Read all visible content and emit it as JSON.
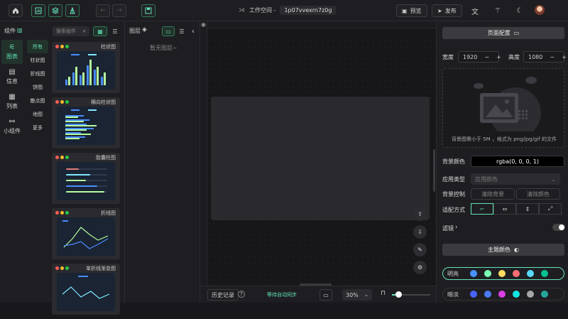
{
  "topbar": {
    "workspace_label": "工作空间 -",
    "workspace_name": "1p07vvexrn7z0g",
    "preview_label": "预览",
    "publish_label": "发布"
  },
  "components_panel": {
    "title": "组件",
    "search_placeholder": "搜索组件",
    "categories": [
      {
        "label": "图表",
        "icon": "chart-icon",
        "active": true
      },
      {
        "label": "信息",
        "icon": "info-icon",
        "active": false
      },
      {
        "label": "列表",
        "icon": "table-icon",
        "active": false
      },
      {
        "label": "小组件",
        "icon": "widget-icon",
        "active": false
      }
    ],
    "subcategories": [
      "所有",
      "柱状图",
      "折线图",
      "饼图",
      "散点图",
      "地图",
      "更多"
    ],
    "thumbnails": [
      {
        "title": "柱状图",
        "kind": "bar"
      },
      {
        "title": "横向柱状图",
        "kind": "hbar"
      },
      {
        "title": "胶囊柱图",
        "kind": "capsule"
      },
      {
        "title": "折线图",
        "kind": "line"
      },
      {
        "title": "单折线渐变图",
        "kind": "gradient-line"
      }
    ]
  },
  "layers_panel": {
    "title": "图层",
    "empty_text": "暂无图层~"
  },
  "canvas": {
    "history_label": "历史记录",
    "sync_status": "等待自动同步",
    "zoom_value": "30%"
  },
  "config_panel": {
    "page_config_label": "页面配置",
    "width_label": "宽度",
    "width_value": "1920",
    "height_label": "高度",
    "height_value": "1080",
    "upload_hint": "背景图需小于 5M ，格式为 png/jpg/gif 的文件",
    "bg_color_label": "背景颜色",
    "bg_color_value": "rgba(0, 0, 0, 1)",
    "apply_type_label": "应用类型",
    "apply_type_placeholder": "应用颜色",
    "bg_control_label": "背景控制",
    "clear_bg_label": "清除背景",
    "clear_color_label": "清除颜色",
    "fit_mode_label": "适配方式",
    "filter_label": "滤镜",
    "theme_color_label": "主题颜色",
    "themes": [
      {
        "name": "明亮",
        "colors": [
          "#4992ff",
          "#7cffb2",
          "#fddd60",
          "#ff6e76",
          "#58d9f9",
          "#05c091"
        ]
      },
      {
        "name": "暗淡",
        "colors": [
          "#4962fc",
          "#4b7cf3",
          "#dd3ee5",
          "#12e6e3",
          "#a7a7a7",
          "#26a69a"
        ]
      }
    ],
    "accent_color": "#63e2b7"
  }
}
